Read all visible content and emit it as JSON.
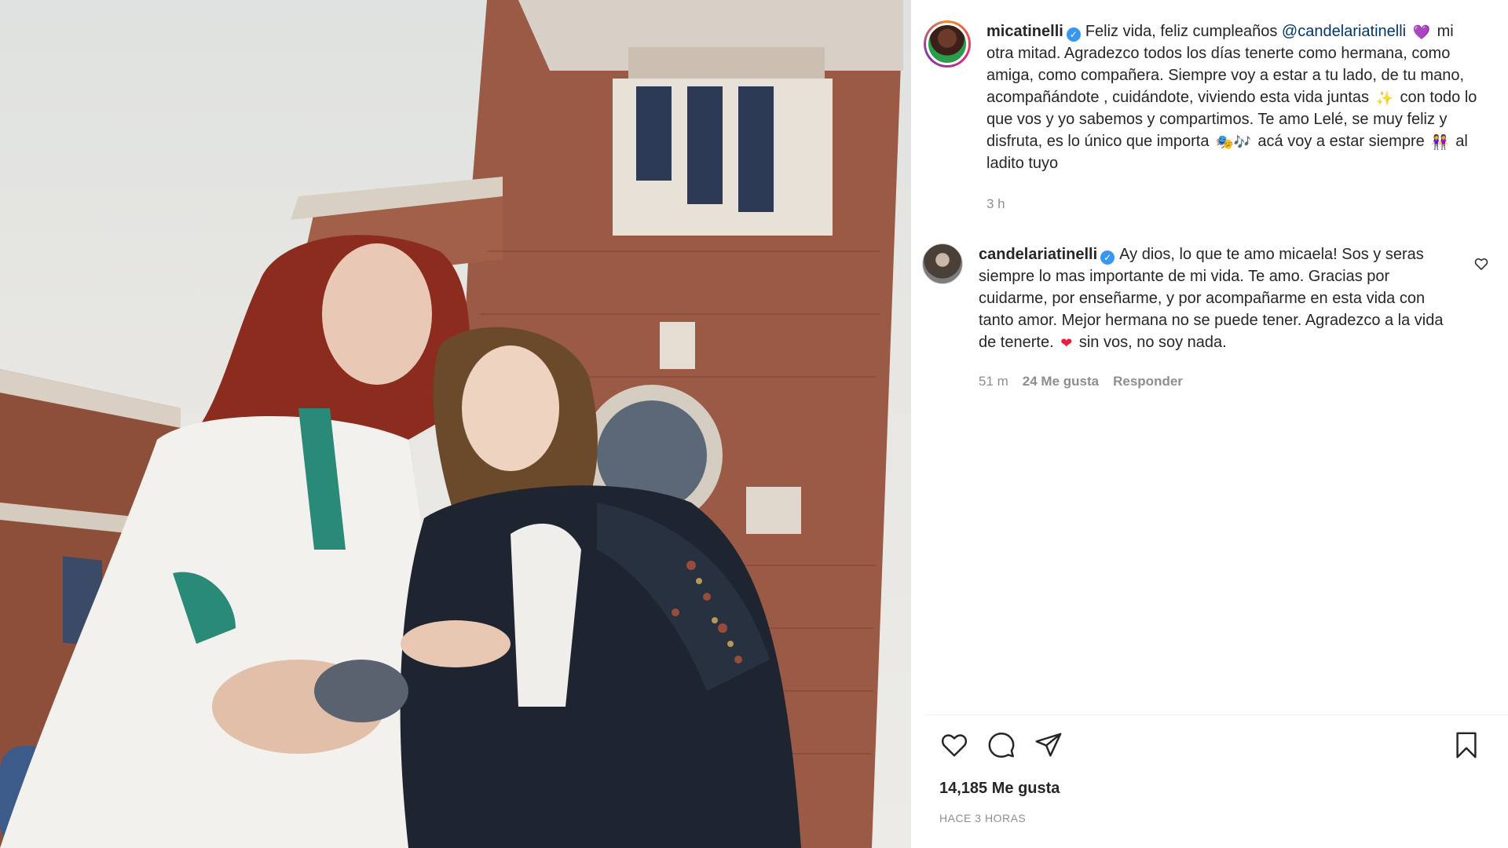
{
  "post": {
    "author": "micatinelli",
    "caption_parts": [
      "Feliz vida, feliz cumpleaños ",
      "@candelariatinelli",
      " mi otra mitad. Agradezco todos los días tenerte como hermana, como amiga, como compañera. Siempre voy a estar a tu lado, de tu mano, acompañándote , cuidándote, viviendo esta vida juntas ",
      " con todo lo que vos y yo sabemos y compartimos. Te amo Lelé, se muy feliz y disfruta, es lo único que importa ",
      " acá voy a estar siempre ",
      " al ladito tuyo"
    ],
    "emojis": [
      "💜",
      "✨",
      "🎭🎶",
      "👭"
    ],
    "caption_time": "3 h"
  },
  "reply": {
    "author": "candelariatinelli",
    "text_parts": [
      "Ay dios, lo que te amo micaela! Sos y seras siempre lo mas importante de mi vida. Te amo. Gracias por cuidarme, por enseñarme, y por acompañarme en esta vida con tanto amor. Mejor hermana no se puede tener. Agradezco a la vida de tenerte. ",
      " sin vos, no soy nada."
    ],
    "emoji": "❤",
    "time": "51 m",
    "likes": "24 Me gusta",
    "reply_label": "Responder"
  },
  "footer": {
    "likes": "14,185 Me gusta",
    "time_ago": "HACE 3 HORAS"
  },
  "icons": [
    "heart-icon",
    "comment-icon",
    "share-icon",
    "bookmark-icon",
    "verified-icon"
  ],
  "colors": {
    "verified": "#3897f0",
    "mention": "#00376b",
    "muted": "#8e8e8e"
  }
}
